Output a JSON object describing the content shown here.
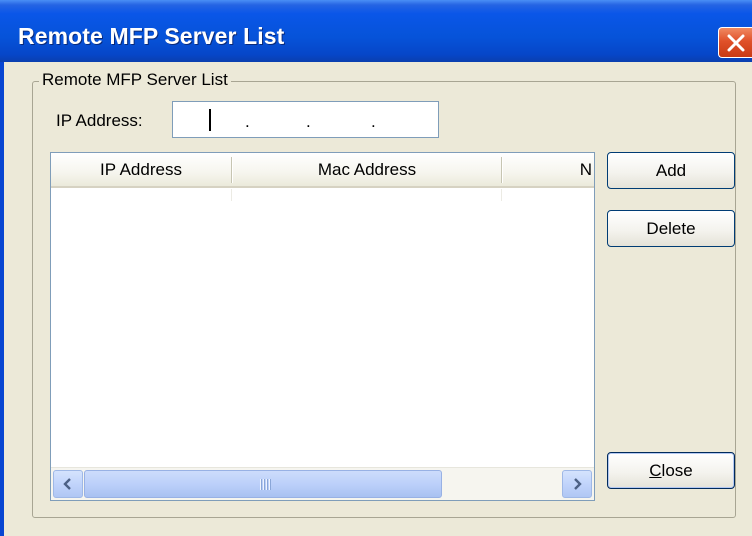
{
  "window": {
    "title": "Remote MFP Server List"
  },
  "group": {
    "legend": "Remote MFP Server List"
  },
  "ip_input": {
    "label": "IP Address:",
    "dots": [
      ".",
      ".",
      "."
    ]
  },
  "list": {
    "columns": [
      "IP Address",
      "Mac Address",
      "N"
    ],
    "rows": []
  },
  "buttons": {
    "add": "Add",
    "delete": "Delete",
    "close_mnemonic": "C",
    "close_rest": "lose"
  },
  "scrollbar": {
    "grip": "III"
  },
  "colors": {
    "titlebar": "#0653d9",
    "dialog_bg": "#ece9d8",
    "close_red": "#e0512a"
  },
  "icons": [
    "close-icon",
    "scroll-left-arrow-icon",
    "scroll-right-arrow-icon"
  ]
}
